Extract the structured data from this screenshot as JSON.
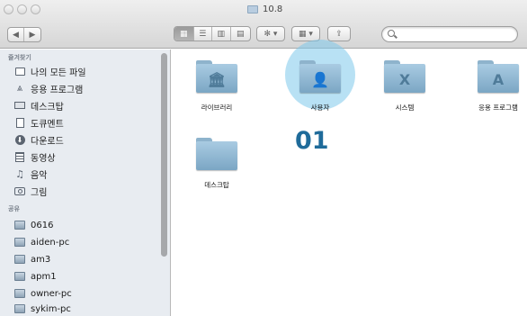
{
  "window": {
    "title": "10.8"
  },
  "toolbar": {
    "back_glyph": "◀",
    "forward_glyph": "▶",
    "view_icons": [
      "icon-view-icon",
      "list-view-icon",
      "column-view-icon",
      "coverflow-view-icon"
    ],
    "action_glyph": "✻ ▾",
    "arrange_glyph": "▦ ▾",
    "share_glyph": "⇪",
    "search_placeholder": ""
  },
  "sidebar": {
    "favorites_header": "즐겨찾기",
    "favorites": [
      {
        "label": "나의 모든 파일",
        "icon": "all-files-icon"
      },
      {
        "label": "응용 프로그램",
        "icon": "applications-icon"
      },
      {
        "label": "데스크탑",
        "icon": "desktop-icon"
      },
      {
        "label": "도큐멘트",
        "icon": "documents-icon"
      },
      {
        "label": "다운로드",
        "icon": "downloads-icon"
      },
      {
        "label": "동영상",
        "icon": "movies-icon"
      },
      {
        "label": "음악",
        "icon": "music-icon"
      },
      {
        "label": "그림",
        "icon": "pictures-icon"
      }
    ],
    "shared_header": "공유",
    "shared": [
      {
        "label": "0616",
        "icon": "computer-icon"
      },
      {
        "label": "aiden-pc",
        "icon": "computer-icon"
      },
      {
        "label": "am3",
        "icon": "computer-icon"
      },
      {
        "label": "apm1",
        "icon": "computer-icon"
      },
      {
        "label": "owner-pc",
        "icon": "computer-icon"
      },
      {
        "label": "sykim-pc",
        "icon": "computer-icon"
      }
    ]
  },
  "main": {
    "items": [
      {
        "label": "라이브러리",
        "emblem": "🏛"
      },
      {
        "label": "사용자",
        "emblem": "👤"
      },
      {
        "label": "시스템",
        "emblem": "X"
      },
      {
        "label": "응용 프로그램",
        "emblem": "A"
      },
      {
        "label": "데스크탑",
        "emblem": ""
      }
    ],
    "annotation_number": "01"
  },
  "colors": {
    "annotation": "#1f6b9a",
    "highlight": "#7dc8eb",
    "folder": "#8eb6d2",
    "sidebar_bg": "#e8ecf1"
  }
}
